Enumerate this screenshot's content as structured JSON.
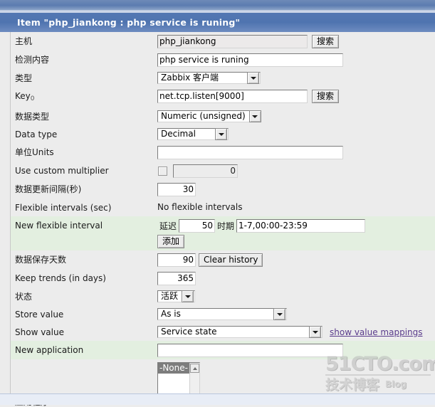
{
  "window": {
    "title": "Item \"php_jiankong : php service is runing\""
  },
  "form": {
    "rows": [
      {
        "name": "host",
        "label": "主机",
        "control": "text-with-button",
        "value": "php_jiankong",
        "readonly": true,
        "button": "搜索"
      },
      {
        "name": "description",
        "label": "检测内容",
        "control": "text",
        "value": "php service is runing"
      },
      {
        "name": "type",
        "label": "类型",
        "control": "select",
        "value": "Zabbix 客户端"
      },
      {
        "name": "key",
        "label": "Key",
        "label_sub": "0",
        "control": "text-with-button",
        "value": "net.tcp.listen[9000]",
        "button": "搜索"
      },
      {
        "name": "value-type",
        "label": "数据类型",
        "control": "select",
        "value": "Numeric (unsigned)"
      },
      {
        "name": "data-type",
        "label": "Data type",
        "control": "select",
        "value": "Decimal"
      },
      {
        "name": "units",
        "label": "单位Units",
        "control": "text",
        "value": ""
      },
      {
        "name": "use-custom-multiplier",
        "label": "Use custom multiplier",
        "control": "checkbox-number",
        "checked": false,
        "value": "0"
      },
      {
        "name": "update-interval",
        "label": "数据更新间隔(秒)",
        "control": "number",
        "value": "30"
      },
      {
        "name": "flexible-intervals",
        "label": "Flexible intervals (sec)",
        "control": "static",
        "value": "No flexible intervals"
      },
      {
        "name": "new-flexible-interval",
        "label": "New flexible interval",
        "control": "flexible-interval",
        "highlight": true,
        "delay_label": "延迟",
        "delay_value": "50",
        "period_label": "时期",
        "period_value": "1-7,00:00-23:59",
        "add_button": "添加"
      },
      {
        "name": "history-days",
        "label": "数据保存天数",
        "control": "number-with-button",
        "value": "90",
        "button": "Clear history"
      },
      {
        "name": "keep-trends",
        "label": "Keep trends (in days)",
        "control": "number",
        "value": "365"
      },
      {
        "name": "status",
        "label": "状态",
        "control": "select",
        "value": "活跃"
      },
      {
        "name": "store-value",
        "label": "Store value",
        "control": "select",
        "value": "As is"
      },
      {
        "name": "show-value",
        "label": "Show value",
        "control": "select-with-link",
        "value": "Service state",
        "link": "show value mappings"
      },
      {
        "name": "new-application",
        "label": "New application",
        "control": "text",
        "highlight": true,
        "value": ""
      },
      {
        "name": "applications",
        "label": "应用程序",
        "control": "listbox",
        "option": "-None-"
      }
    ]
  },
  "watermark": {
    "line1": "51CTO.com",
    "line2": "技术博客",
    "line2_suffix": "Blog"
  }
}
